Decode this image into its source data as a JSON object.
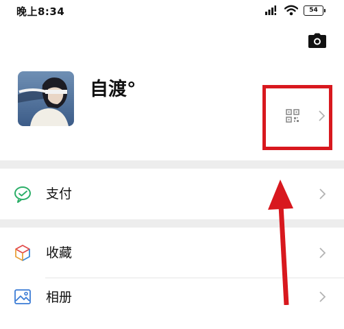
{
  "status_bar": {
    "time": "晚上8:34",
    "battery": "54"
  },
  "profile": {
    "nickname": "自渡°"
  },
  "menu": [
    {
      "label": "支付",
      "icon": "wechat-pay-icon",
      "color": "#2aae67"
    },
    {
      "label": "收藏",
      "icon": "favorites-cube-icon",
      "color": "#e9a13a"
    },
    {
      "label": "相册",
      "icon": "photo-album-icon",
      "color": "#3a7bd5"
    }
  ],
  "colors": {
    "highlight": "#d8181e",
    "separator": "#ededed"
  }
}
